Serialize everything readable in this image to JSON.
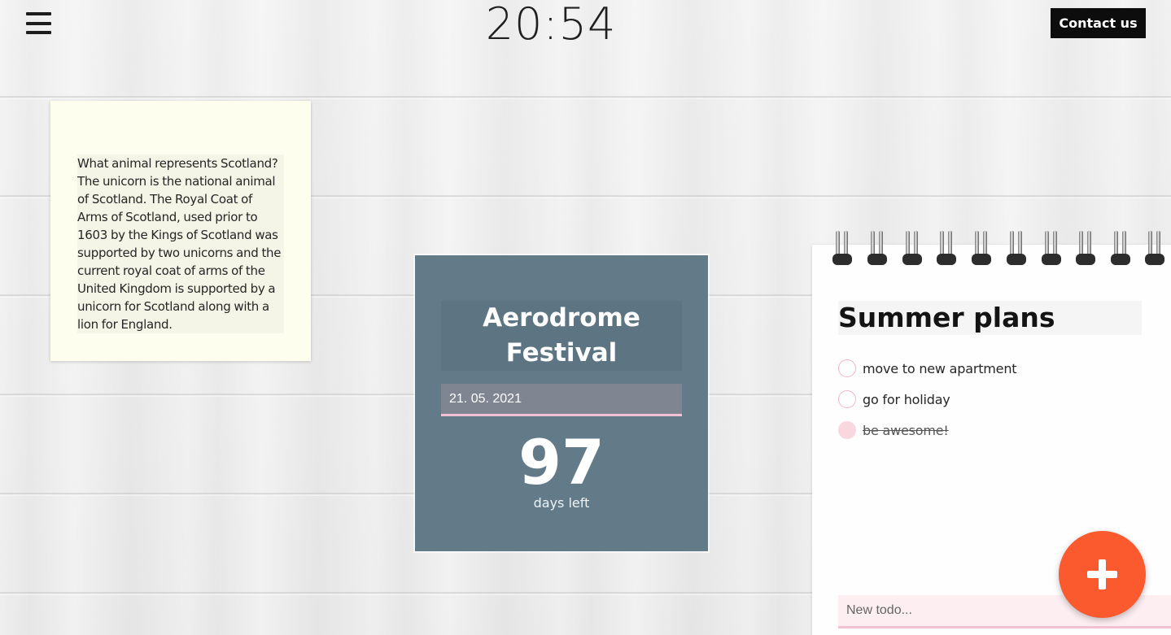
{
  "header": {
    "menu_icon": "hamburger-menu-icon",
    "clock": "20:54",
    "contact_label": "Contact us"
  },
  "sticky_note": {
    "text": "What animal represents Scotland? The unicorn is the national animal of Scotland. The Royal Coat of Arms of Scotland, used prior to 1603 by the Kings of Scotland was supported by two unicorns and the current royal coat of arms of the United Kingdom is supported by a unicorn for Scotland along with a lion for England."
  },
  "countdown": {
    "title_line1": "Aerodrome",
    "title_line2": "Festival",
    "date": "21. 05. 2021",
    "days": "97",
    "days_label": "days left"
  },
  "notebook": {
    "title": "Summer plans",
    "todos": [
      {
        "text": "move to new apartment",
        "done": false
      },
      {
        "text": "go for holiday",
        "done": false
      },
      {
        "text": "be awesome!",
        "done": true
      }
    ],
    "new_todo_placeholder": "New todo..."
  },
  "add_button_icon": "plus-icon",
  "colors": {
    "accent": "#fb5a2e",
    "countdown_bg": "#637b89",
    "sticky_bg": "#fdfeee",
    "pink": "#f2c1d2"
  }
}
